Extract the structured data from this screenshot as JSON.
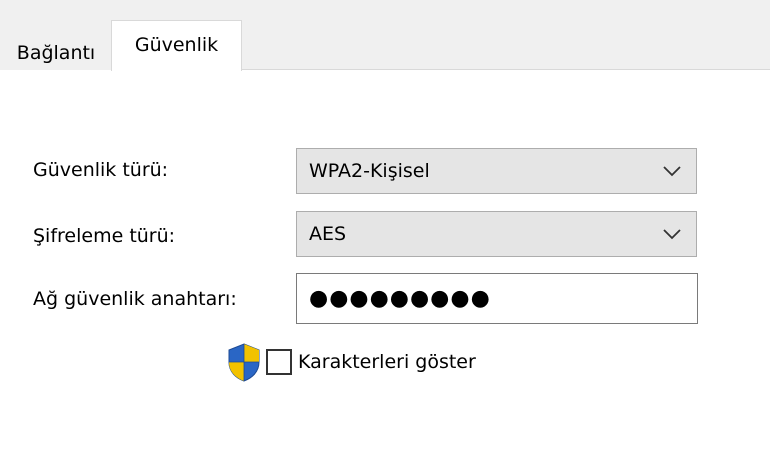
{
  "tabs": [
    {
      "label": "Bağlantı",
      "active": false
    },
    {
      "label": "Güvenlik",
      "active": true
    }
  ],
  "form": {
    "security_type": {
      "label": "Güvenlik türü:",
      "value": "WPA2-Kişisel"
    },
    "encryption_type": {
      "label": "Şifreleme türü:",
      "value": "AES"
    },
    "network_key": {
      "label": "Ağ güvenlik anahtarı:",
      "masked_value": "●●●●●●●●●"
    },
    "show_characters": {
      "label": "Karakterleri göster",
      "checked": false
    }
  },
  "icons": {
    "dropdown": "chevron-down-icon",
    "shield": "uac-shield-icon"
  },
  "colors": {
    "tab_strip": "#f0f0f0",
    "select_bg": "#e5e5e5",
    "shield_blue": "#2a66c5",
    "shield_yellow": "#f2c200"
  }
}
